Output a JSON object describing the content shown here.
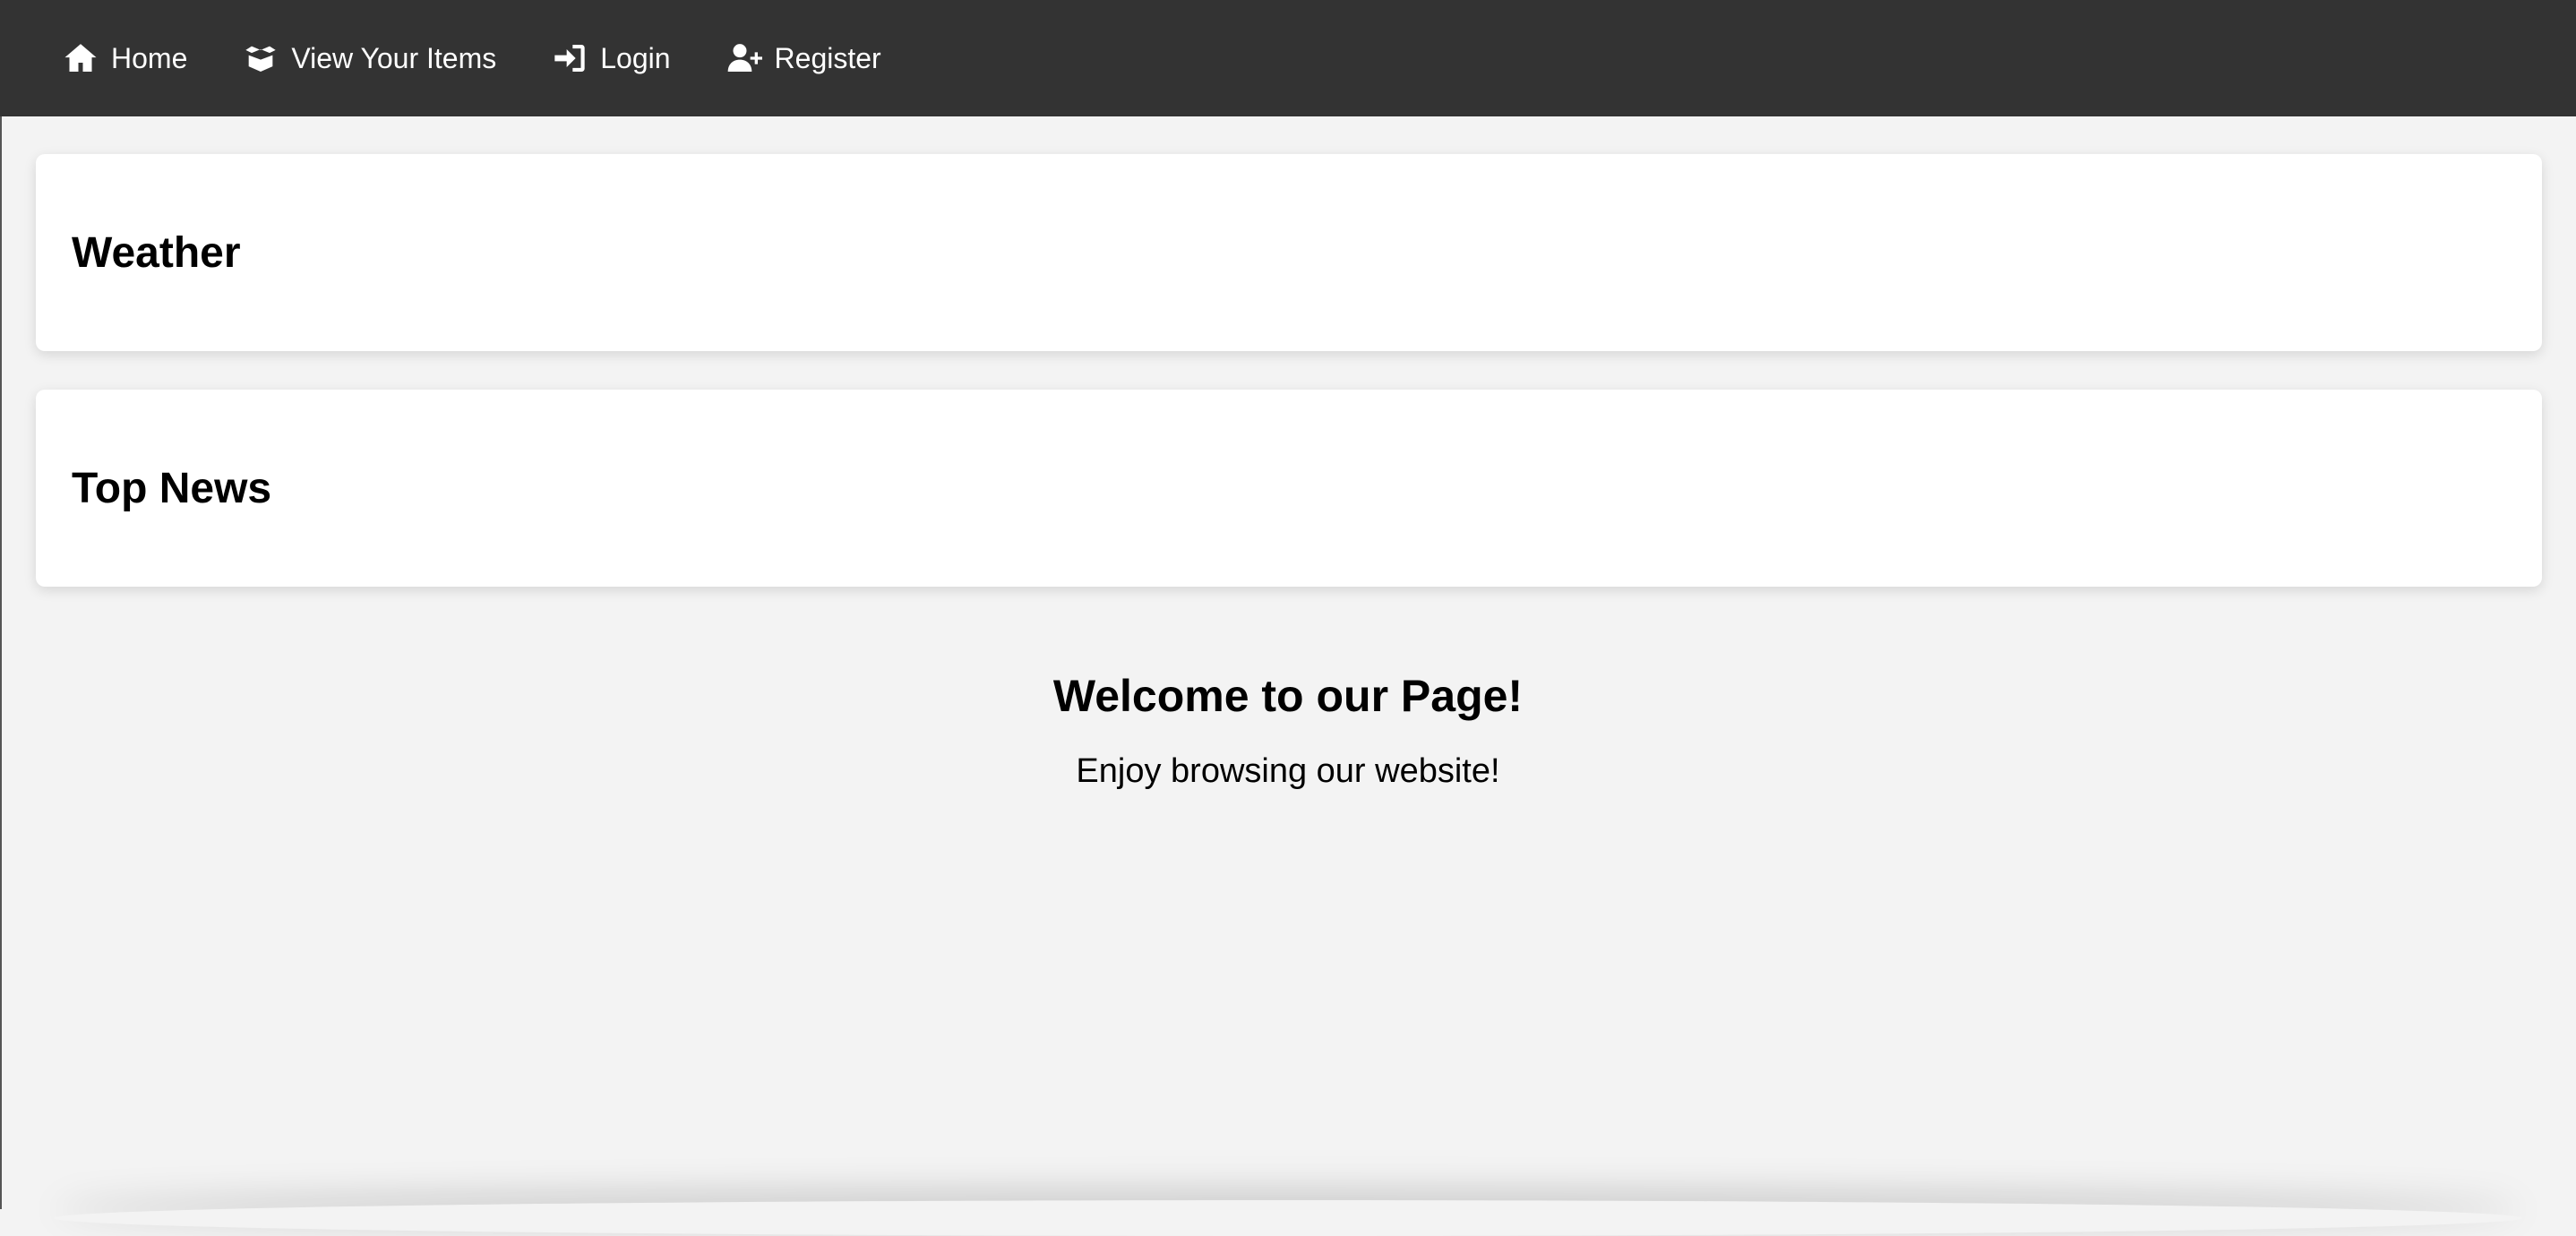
{
  "nav": {
    "items": [
      {
        "label": "Home",
        "icon": "home-icon"
      },
      {
        "label": "View Your Items",
        "icon": "box-open-icon"
      },
      {
        "label": "Login",
        "icon": "sign-in-icon"
      },
      {
        "label": "Register",
        "icon": "user-plus-icon"
      }
    ]
  },
  "cards": {
    "weather_title": "Weather",
    "news_title": "Top News"
  },
  "welcome": {
    "heading": "Welcome to our Page!",
    "subtext": "Enjoy browsing our website!"
  },
  "colors": {
    "navbar_bg": "#333333",
    "page_bg": "#f3f3f3",
    "card_bg": "#ffffff",
    "text": "#000000"
  }
}
